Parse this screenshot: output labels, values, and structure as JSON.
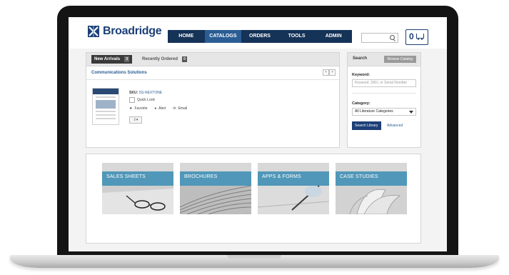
{
  "brand": {
    "name": "Broadridge",
    "color": "#1c3f77"
  },
  "nav": [
    {
      "label": "HOME",
      "active": false
    },
    {
      "label": "CATALOGS",
      "active": true
    },
    {
      "label": "ORDERS",
      "active": false
    },
    {
      "label": "TOOLS",
      "active": false
    },
    {
      "label": "ADMIN",
      "active": false
    }
  ],
  "cart": {
    "count": "0",
    "icon": "cart-icon"
  },
  "tabs": {
    "new_arrivals": {
      "label": "New Arrivals",
      "count": "3"
    },
    "recently_ordered": {
      "label": "Recently Ordered",
      "count": "0"
    }
  },
  "catalog": {
    "title": "Communications Solutions",
    "sku_label": "SKU:",
    "sku_value": "SS-NEXTONE",
    "quick_look": "Quick Look",
    "favorite": "Favorite",
    "alert": "Alert",
    "email": "Email"
  },
  "search_panel": {
    "title": "Search",
    "browse_label": "Browse Catalog",
    "keyword_label": "Keyword:",
    "keyword_placeholder": "Keyword, SKU, or Serial Number",
    "category_label": "Category:",
    "category_value": "All Literature Categories",
    "search_button": "Search Library",
    "advanced_link": "Advanced"
  },
  "tiles": [
    {
      "label": "SALES SHEETS"
    },
    {
      "label": "BROCHURES"
    },
    {
      "label": "APPS & FORMS"
    },
    {
      "label": "CASE STUDIES"
    }
  ]
}
